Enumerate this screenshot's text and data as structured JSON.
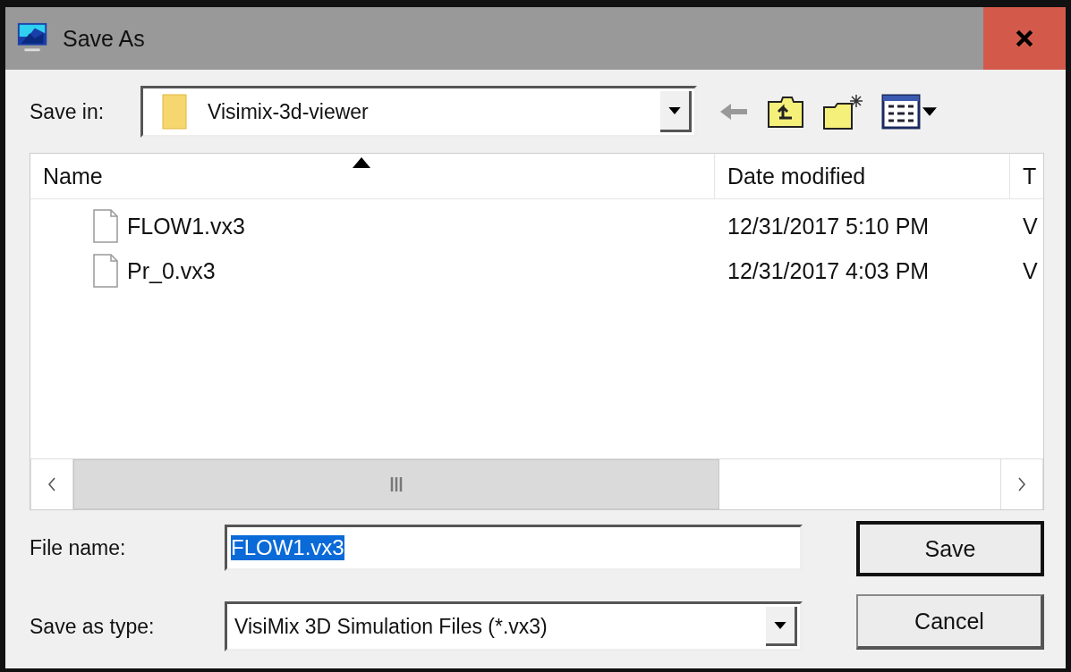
{
  "window": {
    "title": "Save As"
  },
  "save_in": {
    "label": "Save in:",
    "value": "Visimix-3d-viewer"
  },
  "file_list": {
    "columns": [
      {
        "label": "Name",
        "sorted": true
      },
      {
        "label": "Date modified",
        "sorted": false
      },
      {
        "label": "T",
        "sorted": false
      }
    ],
    "rows": [
      {
        "name": "FLOW1.vx3",
        "date": "12/31/2017 5:10 PM",
        "type": "V",
        "selected": false
      },
      {
        "name": "Pr_0.vx3",
        "date": "12/31/2017 4:03 PM",
        "type": "V",
        "selected": false
      }
    ]
  },
  "file_name": {
    "label": "File name:",
    "value": "FLOW1.vx3",
    "value_selected": true
  },
  "save_type": {
    "label": "Save as type:",
    "value": "VisiMix 3D Simulation Files (*.vx3)"
  },
  "buttons": [
    {
      "label": "Save",
      "default": true
    },
    {
      "label": "Cancel",
      "default": false
    }
  ]
}
